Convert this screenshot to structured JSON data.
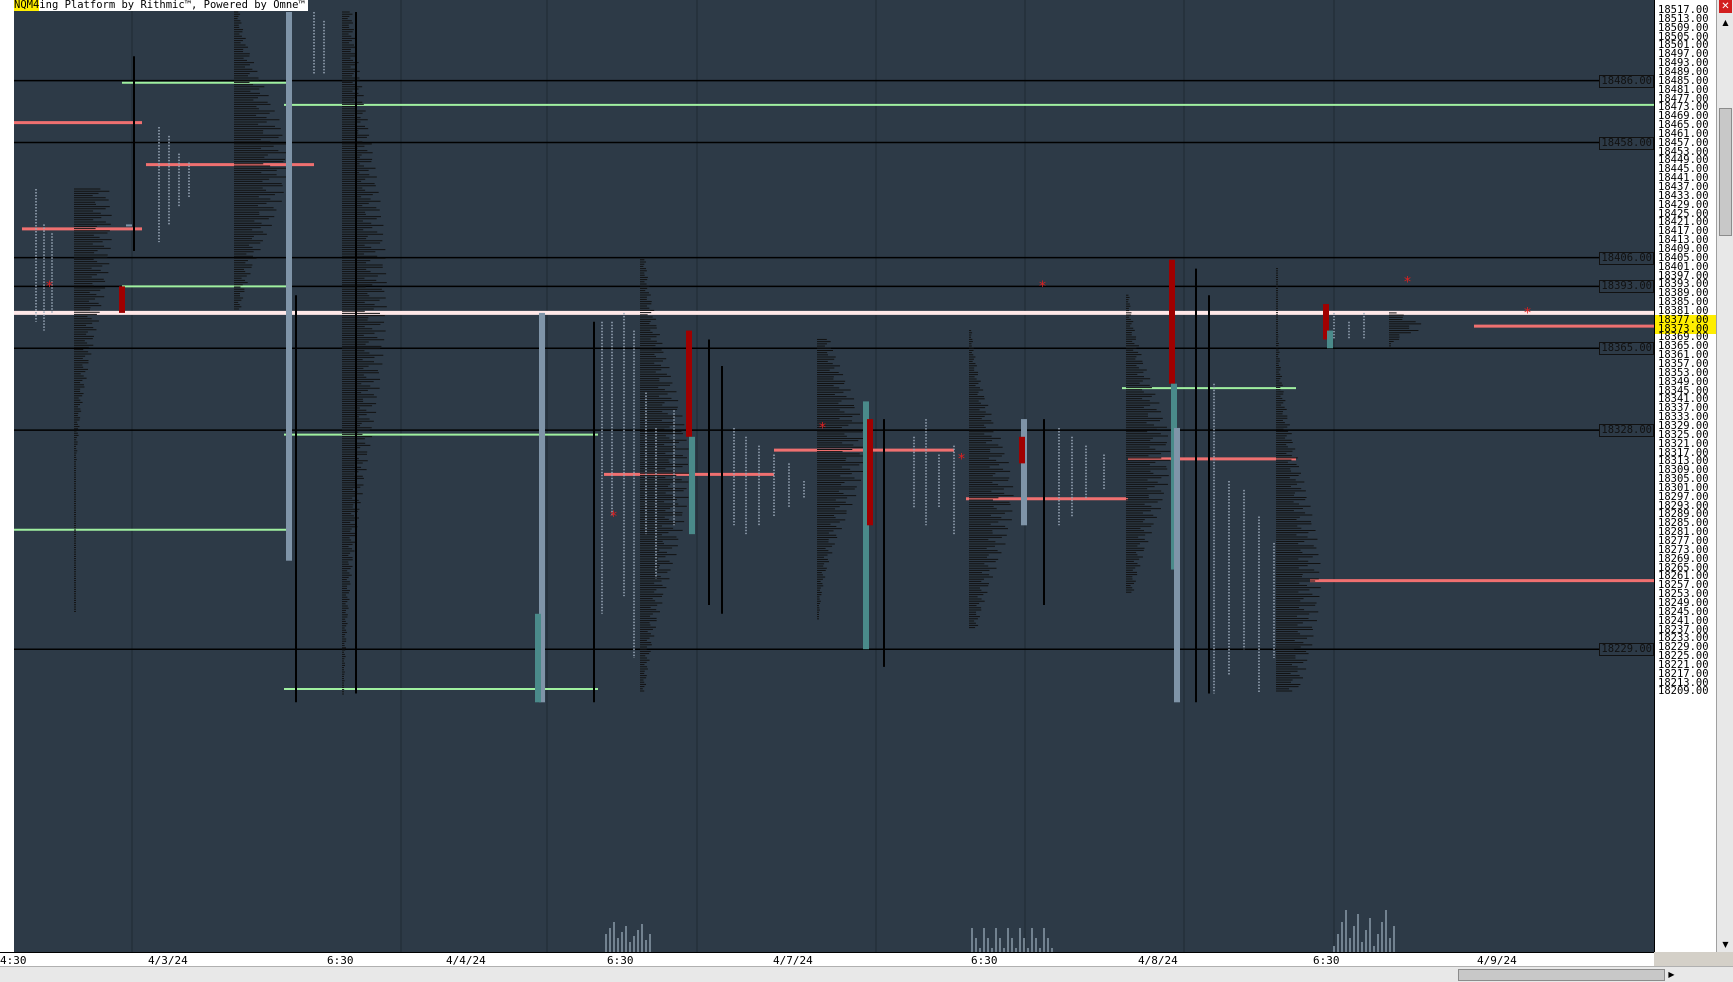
{
  "title": {
    "symbol": "NQM4",
    "text": "ing Platform by Rithmic™, Powered by Omne™"
  },
  "price_axis": {
    "ticks": [
      "18517.00",
      "18513.00",
      "18509.00",
      "18505.00",
      "18501.00",
      "18497.00",
      "18493.00",
      "18489.00",
      "18485.00",
      "18481.00",
      "18477.00",
      "18473.00",
      "18469.00",
      "18465.00",
      "18461.00",
      "18457.00",
      "18453.00",
      "18449.00",
      "18445.00",
      "18441.00",
      "18437.00",
      "18433.00",
      "18429.00",
      "18425.00",
      "18421.00",
      "18417.00",
      "18413.00",
      "18409.00",
      "18405.00",
      "18401.00",
      "18397.00",
      "18393.00",
      "18389.00",
      "18385.00",
      "18381.00",
      "18377.00",
      "18373.00",
      "18369.00",
      "18365.00",
      "18361.00",
      "18357.00",
      "18353.00",
      "18349.00",
      "18345.00",
      "18341.00",
      "18337.00",
      "18333.00",
      "18329.00",
      "18325.00",
      "18321.00",
      "18317.00",
      "18313.00",
      "18309.00",
      "18305.00",
      "18301.00",
      "18297.00",
      "18293.00",
      "18289.00",
      "18285.00",
      "18281.00",
      "18277.00",
      "18273.00",
      "18269.00",
      "18265.00",
      "18261.00",
      "18257.00",
      "18253.00",
      "18249.00",
      "18245.00",
      "18241.00",
      "18237.00",
      "18233.00",
      "18229.00",
      "18225.00",
      "18221.00",
      "18217.00",
      "18213.00",
      "18209.00"
    ],
    "highlighted": [
      "18377.00",
      "18373.00"
    ],
    "highlight_color": "#ffee00"
  },
  "levels": [
    {
      "label": "18486.00",
      "price": 18486
    },
    {
      "label": "18458.00",
      "price": 18458
    },
    {
      "label": "18406.00",
      "price": 18406
    },
    {
      "label": "18393.00",
      "price": 18393
    },
    {
      "label": "18365.00",
      "price": 18365
    },
    {
      "label": "18328.00",
      "price": 18328
    },
    {
      "label": "18229.00",
      "price": 18229
    }
  ],
  "time_axis": [
    "4:30",
    "4/3/24",
    "6:30",
    "4/4/24",
    "6:30",
    "4/7/24",
    "6:30",
    "4/8/24",
    "6:30",
    "4/9/24"
  ],
  "colors": {
    "background": "#2d3a47",
    "poc": "#f07070",
    "value_area": "#a0f0a0",
    "profile": "#111111",
    "tpo": "#9aa8b8",
    "open_range": "#a00000",
    "ib": "#4a8a8a",
    "last_price": "#ffe8e8"
  },
  "scroll": {
    "close_icon": "close-icon"
  }
}
